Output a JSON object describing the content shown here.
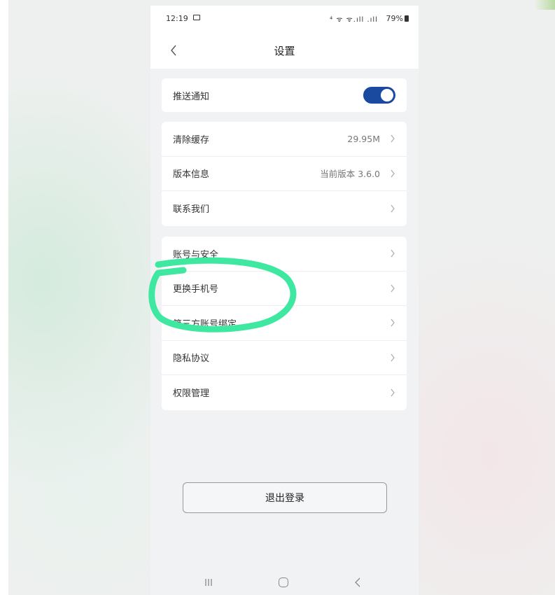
{
  "status_bar": {
    "time": "12:19",
    "icons": "⁴ ᯤ ᯤ.ıll .ıll",
    "battery": "79%"
  },
  "nav": {
    "title": "设置"
  },
  "groups": [
    [
      {
        "label": "推送通知",
        "toggle_on": true
      }
    ],
    [
      {
        "label": "清除缓存",
        "value": "29.95M"
      },
      {
        "label": "版本信息",
        "value": "当前版本 3.6.0"
      },
      {
        "label": "联系我们"
      }
    ],
    [
      {
        "label": "账号与安全"
      },
      {
        "label": "更换手机号"
      },
      {
        "label": "第三方账号绑定"
      },
      {
        "label": "隐私协议"
      },
      {
        "label": "权限管理"
      }
    ]
  ],
  "logout_label": "退出登录",
  "colors": {
    "toggle_accent": "#1a4aa0",
    "annotation_green": "#3fe8a0"
  }
}
